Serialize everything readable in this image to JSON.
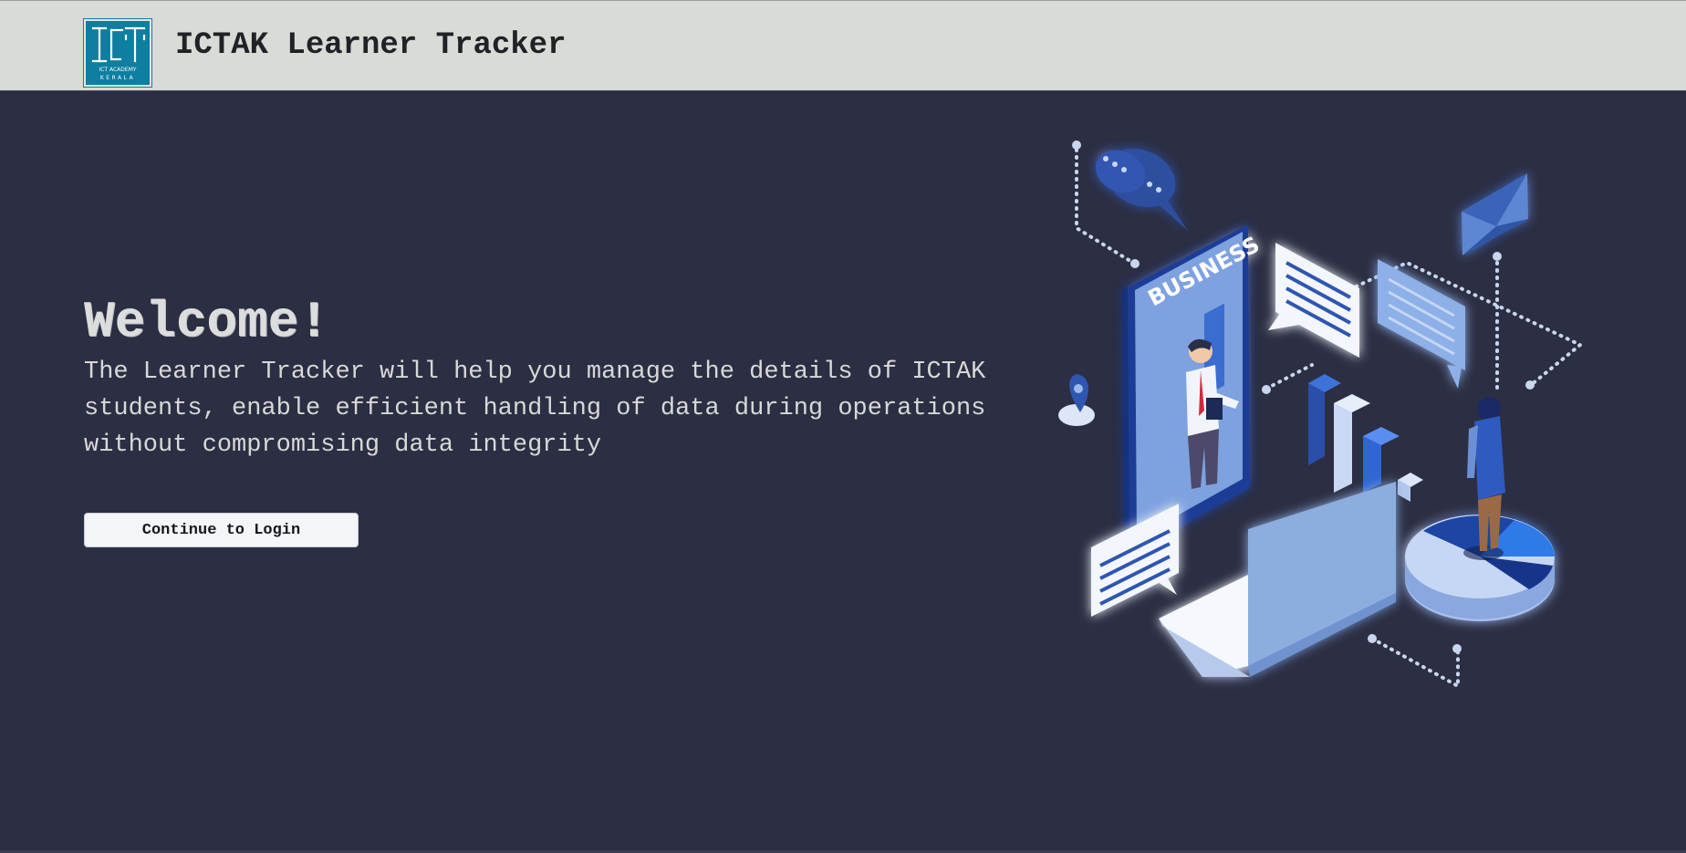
{
  "navbar": {
    "logo_alt": "ICT Academy Kerala logo",
    "logo_text_top": "ICT ACADEMY",
    "logo_text_bottom": "KERALA",
    "title": "ICTAK Learner Tracker"
  },
  "hero": {
    "heading": "Welcome!",
    "description": "The Learner Tracker will help you manage the details of ICTAK students, enable efficient handling of data during operations without compromising data integrity",
    "cta_label": "Continue to Login"
  },
  "illustration": {
    "phone_label": "BUSINESS"
  },
  "colors": {
    "navbar_bg": "#d8dbd6",
    "page_bg": "#2c2e43",
    "logo_bg": "#0f7ea0",
    "accent_blue": "#3b6fd6",
    "light_blue": "#8fb1e6"
  }
}
